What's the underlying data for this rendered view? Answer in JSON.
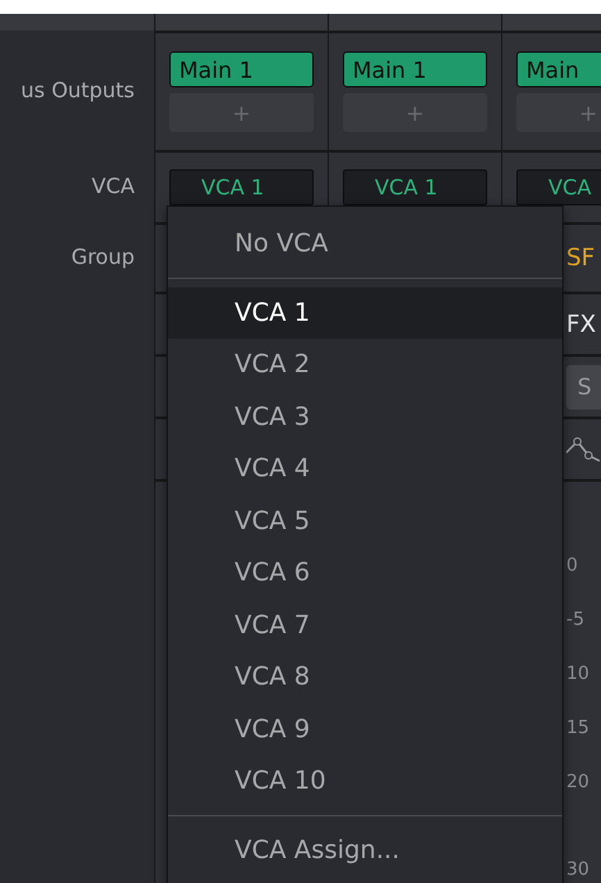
{
  "row_labels": [
    "us Outputs",
    "VCA",
    "Group"
  ],
  "channels": [
    {
      "bus_output": "Main 1",
      "add_button": "+",
      "vca": "VCA 1"
    },
    {
      "bus_output": "Main 1",
      "add_button": "+",
      "vca": "VCA 1"
    },
    {
      "bus_output": "Main",
      "add_button": "+",
      "vca": "VCA",
      "group": "SF",
      "fx": "FX",
      "solo": "S",
      "meter_scale": [
        "0",
        "-5",
        "10",
        "15",
        "20",
        "30"
      ]
    }
  ],
  "menu": {
    "header": "No VCA",
    "items": [
      {
        "label": "VCA 1",
        "selected": true
      },
      {
        "label": "VCA 2",
        "selected": false
      },
      {
        "label": "VCA 3",
        "selected": false
      },
      {
        "label": "VCA 4",
        "selected": false
      },
      {
        "label": "VCA 5",
        "selected": false
      },
      {
        "label": "VCA 6",
        "selected": false
      },
      {
        "label": "VCA 7",
        "selected": false
      },
      {
        "label": "VCA 8",
        "selected": false
      },
      {
        "label": "VCA 9",
        "selected": false
      },
      {
        "label": "VCA 10",
        "selected": false
      }
    ],
    "footer": "VCA Assign..."
  }
}
